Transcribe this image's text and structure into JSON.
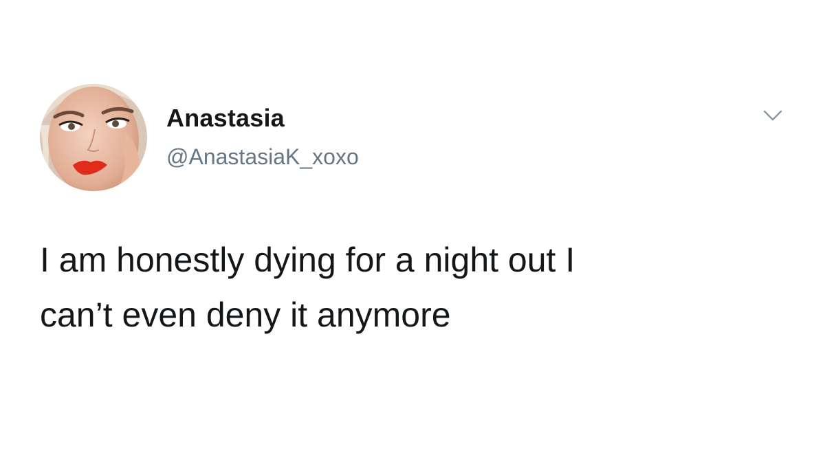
{
  "tweet": {
    "author": {
      "display_name": "Anastasia",
      "handle": "@AnastasiaK_xoxo",
      "avatar_icon": "profile-photo"
    },
    "menu_icon": "chevron-down-icon",
    "text_line_1": "I am honestly dying for a night out I",
    "text_line_2": "can’t even deny it anymore"
  },
  "colors": {
    "background": "#ffffff",
    "text_primary": "#14171a",
    "text_secondary": "#657786",
    "chevron": "#8899a6"
  }
}
